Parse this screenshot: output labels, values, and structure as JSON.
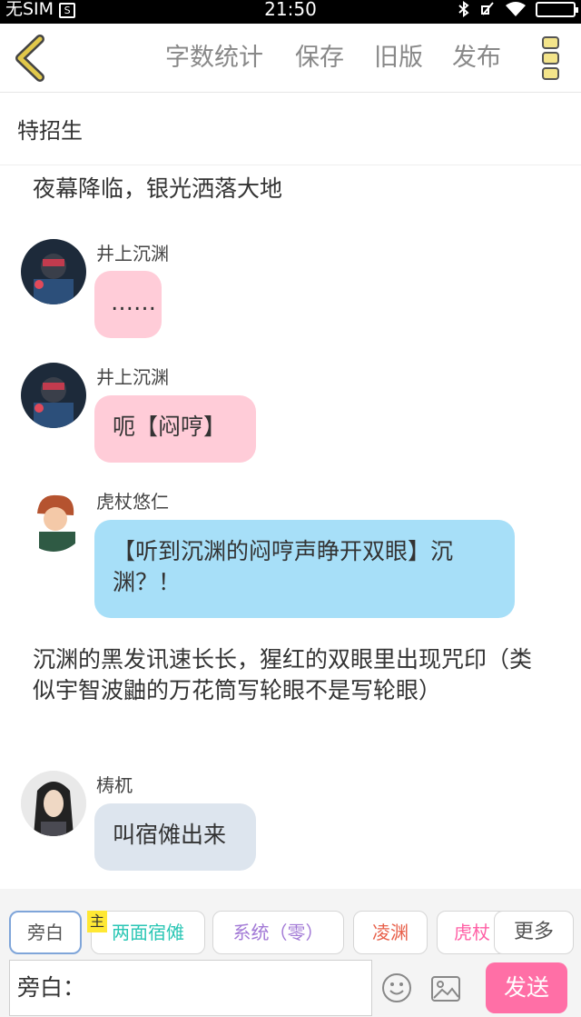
{
  "status_bar": {
    "carrier": "无SIM",
    "sim_icon_glyph": "S",
    "time": "21:50",
    "icons": [
      "bluetooth-icon",
      "no-notification-icon",
      "wifi-icon",
      "battery-icon"
    ]
  },
  "toolbar": {
    "back_icon": "chevron-left-icon",
    "word_count_label": "字数统计",
    "save_label": "保存",
    "old_version_label": "旧版",
    "publish_label": "发布",
    "menu_icon": "three-dots-vertical-icon",
    "accent_color": "#c9b33a"
  },
  "story_title": "特招生",
  "messages": [
    {
      "kind": "narration",
      "text": "夜幕降临，银光洒落大地"
    },
    {
      "kind": "chat",
      "speaker": "井上沉渊",
      "text": "……",
      "bubble_color": "#ffccd8"
    },
    {
      "kind": "chat",
      "speaker": "井上沉渊",
      "text": "呃【闷哼】",
      "bubble_color": "#ffccd8"
    },
    {
      "kind": "chat",
      "speaker": "虎杖悠仁",
      "text": "【听到沉渊的闷哼声睁开双眼】沉渊？！",
      "bubble_color": "#a7dff8"
    },
    {
      "kind": "narration",
      "text": "沉渊的黑发讯速长长，猩红的双眼里出现咒印（类似宇智波鼬的万花筒写轮眼不是写轮眼）"
    },
    {
      "kind": "chat",
      "speaker": "梼杌",
      "text": "叫宿傩出来",
      "bubble_color": "#dde5ee"
    }
  ],
  "role_bar": {
    "roles": [
      {
        "label": "旁白",
        "color": "#555555"
      },
      {
        "label": "两面宿傩",
        "color": "#29c6b4"
      },
      {
        "label": "系统（零）",
        "color": "#a279d6"
      },
      {
        "label": "凌渊",
        "color": "#e8604a"
      },
      {
        "label": "虎杖",
        "color": "#ff5fa5"
      }
    ],
    "main_badge": "主",
    "more_label": "更多"
  },
  "composer": {
    "current_role_prefix": "旁白：",
    "emoji_icon": "emoji-icon",
    "image_icon": "image-icon",
    "send_label": "发送",
    "send_color": "#ff6fa6"
  }
}
